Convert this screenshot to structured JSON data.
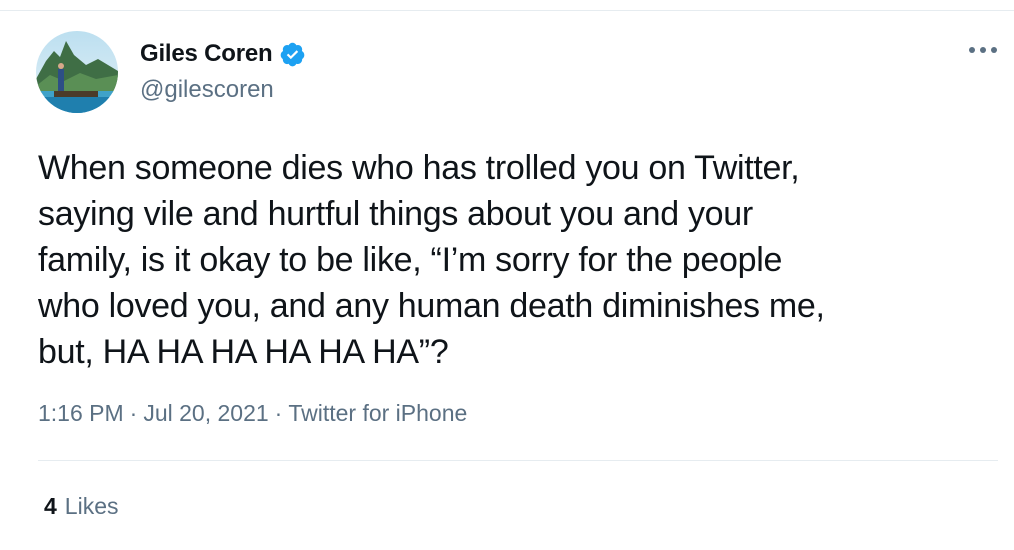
{
  "user": {
    "display_name": "Giles Coren",
    "handle": "@gilescoren",
    "verified": true
  },
  "tweet": {
    "text": "When someone dies who has trolled you on Twitter,\nsaying vile and hurtful things about you and your\nfamily, is it okay to be like, “I’m sorry for the people\nwho loved you, and any human death diminishes me,\nbut, HA HA HA HA HA HA”?",
    "time": "1:16 PM",
    "date": "Jul 20, 2021",
    "separator": "·",
    "source": "Twitter for iPhone"
  },
  "stats": {
    "likes_count": "4",
    "likes_label": "Likes"
  },
  "icons": {
    "verified": "verified-badge-icon",
    "more": "more-options-icon",
    "avatar": "avatar"
  },
  "colors": {
    "verified_blue": "#1da1f2",
    "text_primary": "#0f1419",
    "text_secondary": "#5b7083",
    "border": "#e6ecf0"
  }
}
